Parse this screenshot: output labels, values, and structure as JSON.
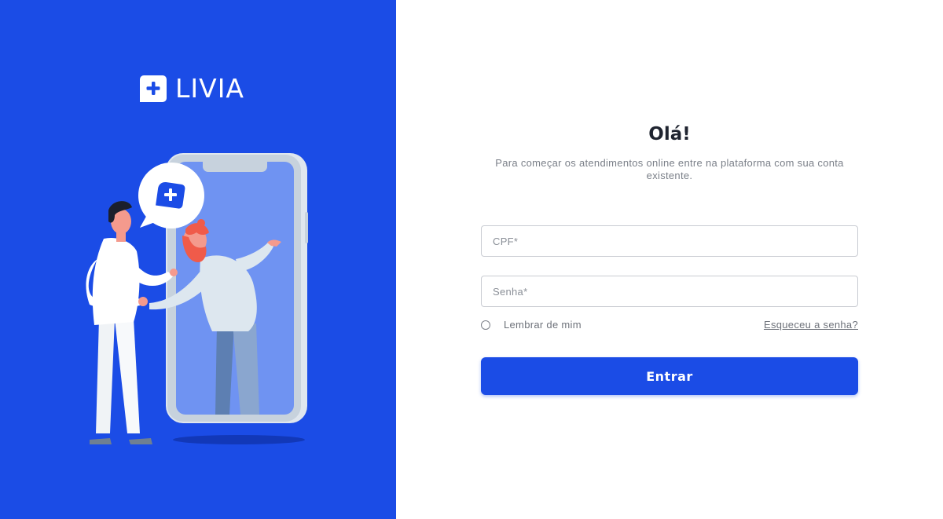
{
  "brand": {
    "name": "LIVIA",
    "color": "#1b4ce6",
    "logo_icon": "chat-plus-icon"
  },
  "login": {
    "title": "Olá!",
    "subtitle": "Para começar os atendimentos online entre na plataforma com sua conta existente.",
    "cpf_placeholder": "CPF*",
    "cpf_value": "",
    "password_placeholder": "Senha*",
    "password_value": "",
    "remember_label": "Lembrar de mim",
    "remember_checked": false,
    "forgot_label": "Esqueceu a senha?",
    "submit_label": "Entrar"
  },
  "illustration": {
    "name": "handshake-through-phone-illustration",
    "bubble_icon": "chat-plus-icon"
  }
}
